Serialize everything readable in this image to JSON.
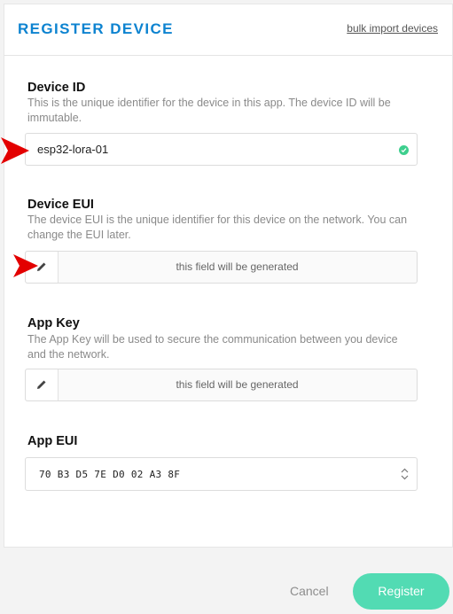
{
  "header": {
    "title": "REGISTER DEVICE",
    "bulk_link": "bulk import devices"
  },
  "device_id": {
    "label": "Device ID",
    "description": "This is the unique identifier for the device in this app. The device ID will be immutable.",
    "value": "esp32-lora-01",
    "status_icon": "check-circle-icon",
    "status_color": "#3ecf8e"
  },
  "device_eui": {
    "label": "Device EUI",
    "description": "The device EUI is the unique identifier for this device on the network. You can change the EUI later.",
    "placeholder": "this field will be generated",
    "edit_icon": "pencil-icon"
  },
  "app_key": {
    "label": "App Key",
    "description": "The App Key will be used to secure the communication between you device and the network.",
    "placeholder": "this field will be generated",
    "edit_icon": "pencil-icon"
  },
  "app_eui": {
    "label": "App EUI",
    "value": "70 B3 D5 7E D0 02 A3 8F",
    "arrow_icon": "chevron-up-down-icon"
  },
  "actions": {
    "cancel": "Cancel",
    "register": "Register"
  },
  "colors": {
    "accent": "#0d83d0",
    "register_button": "#52dbb3",
    "annotation_arrow": "#e30000"
  }
}
